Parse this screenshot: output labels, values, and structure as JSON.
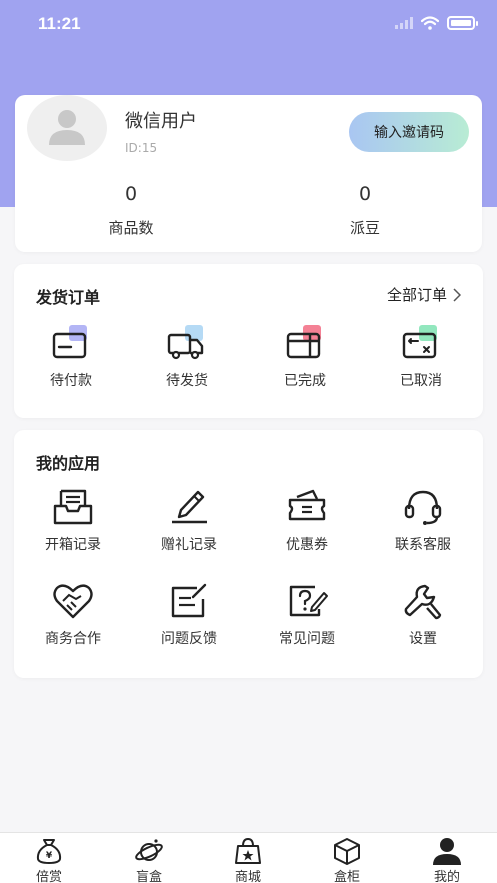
{
  "status_bar": {
    "time": "11:21"
  },
  "profile": {
    "nickname": "微信用户",
    "user_id": "ID:15",
    "invite_label": "输入邀请码",
    "stats": [
      {
        "value": "0",
        "label": "商品数"
      },
      {
        "value": "0",
        "label": "派豆"
      }
    ]
  },
  "orders": {
    "title": "发货订单",
    "all_orders_label": "全部订单",
    "items": [
      {
        "label": "待付款",
        "icon": "wallet-icon",
        "accent": "#9a9cf2"
      },
      {
        "label": "待发货",
        "icon": "truck-icon",
        "accent": "#9ccdf2"
      },
      {
        "label": "已完成",
        "icon": "card-check-icon",
        "accent": "#f26b82"
      },
      {
        "label": "已取消",
        "icon": "card-cancel-icon",
        "accent": "#7fe3b3"
      }
    ]
  },
  "apps": {
    "title": "我的应用",
    "items": [
      {
        "label": "开箱记录",
        "icon": "inbox-icon"
      },
      {
        "label": "赠礼记录",
        "icon": "pen-icon"
      },
      {
        "label": "优惠券",
        "icon": "coupon-icon"
      },
      {
        "label": "联系客服",
        "icon": "headset-icon"
      },
      {
        "label": "商务合作",
        "icon": "handshake-heart-icon"
      },
      {
        "label": "问题反馈",
        "icon": "feedback-icon"
      },
      {
        "label": "常见问题",
        "icon": "faq-icon"
      },
      {
        "label": "设置",
        "icon": "wrench-icon"
      }
    ]
  },
  "tabbar": {
    "items": [
      {
        "label": "倍赏",
        "icon": "money-bag-icon"
      },
      {
        "label": "盲盒",
        "icon": "planet-icon"
      },
      {
        "label": "商城",
        "icon": "shopping-bag-icon"
      },
      {
        "label": "盒柜",
        "icon": "cube-icon"
      },
      {
        "label": "我的",
        "icon": "user-icon",
        "active": true
      }
    ]
  }
}
